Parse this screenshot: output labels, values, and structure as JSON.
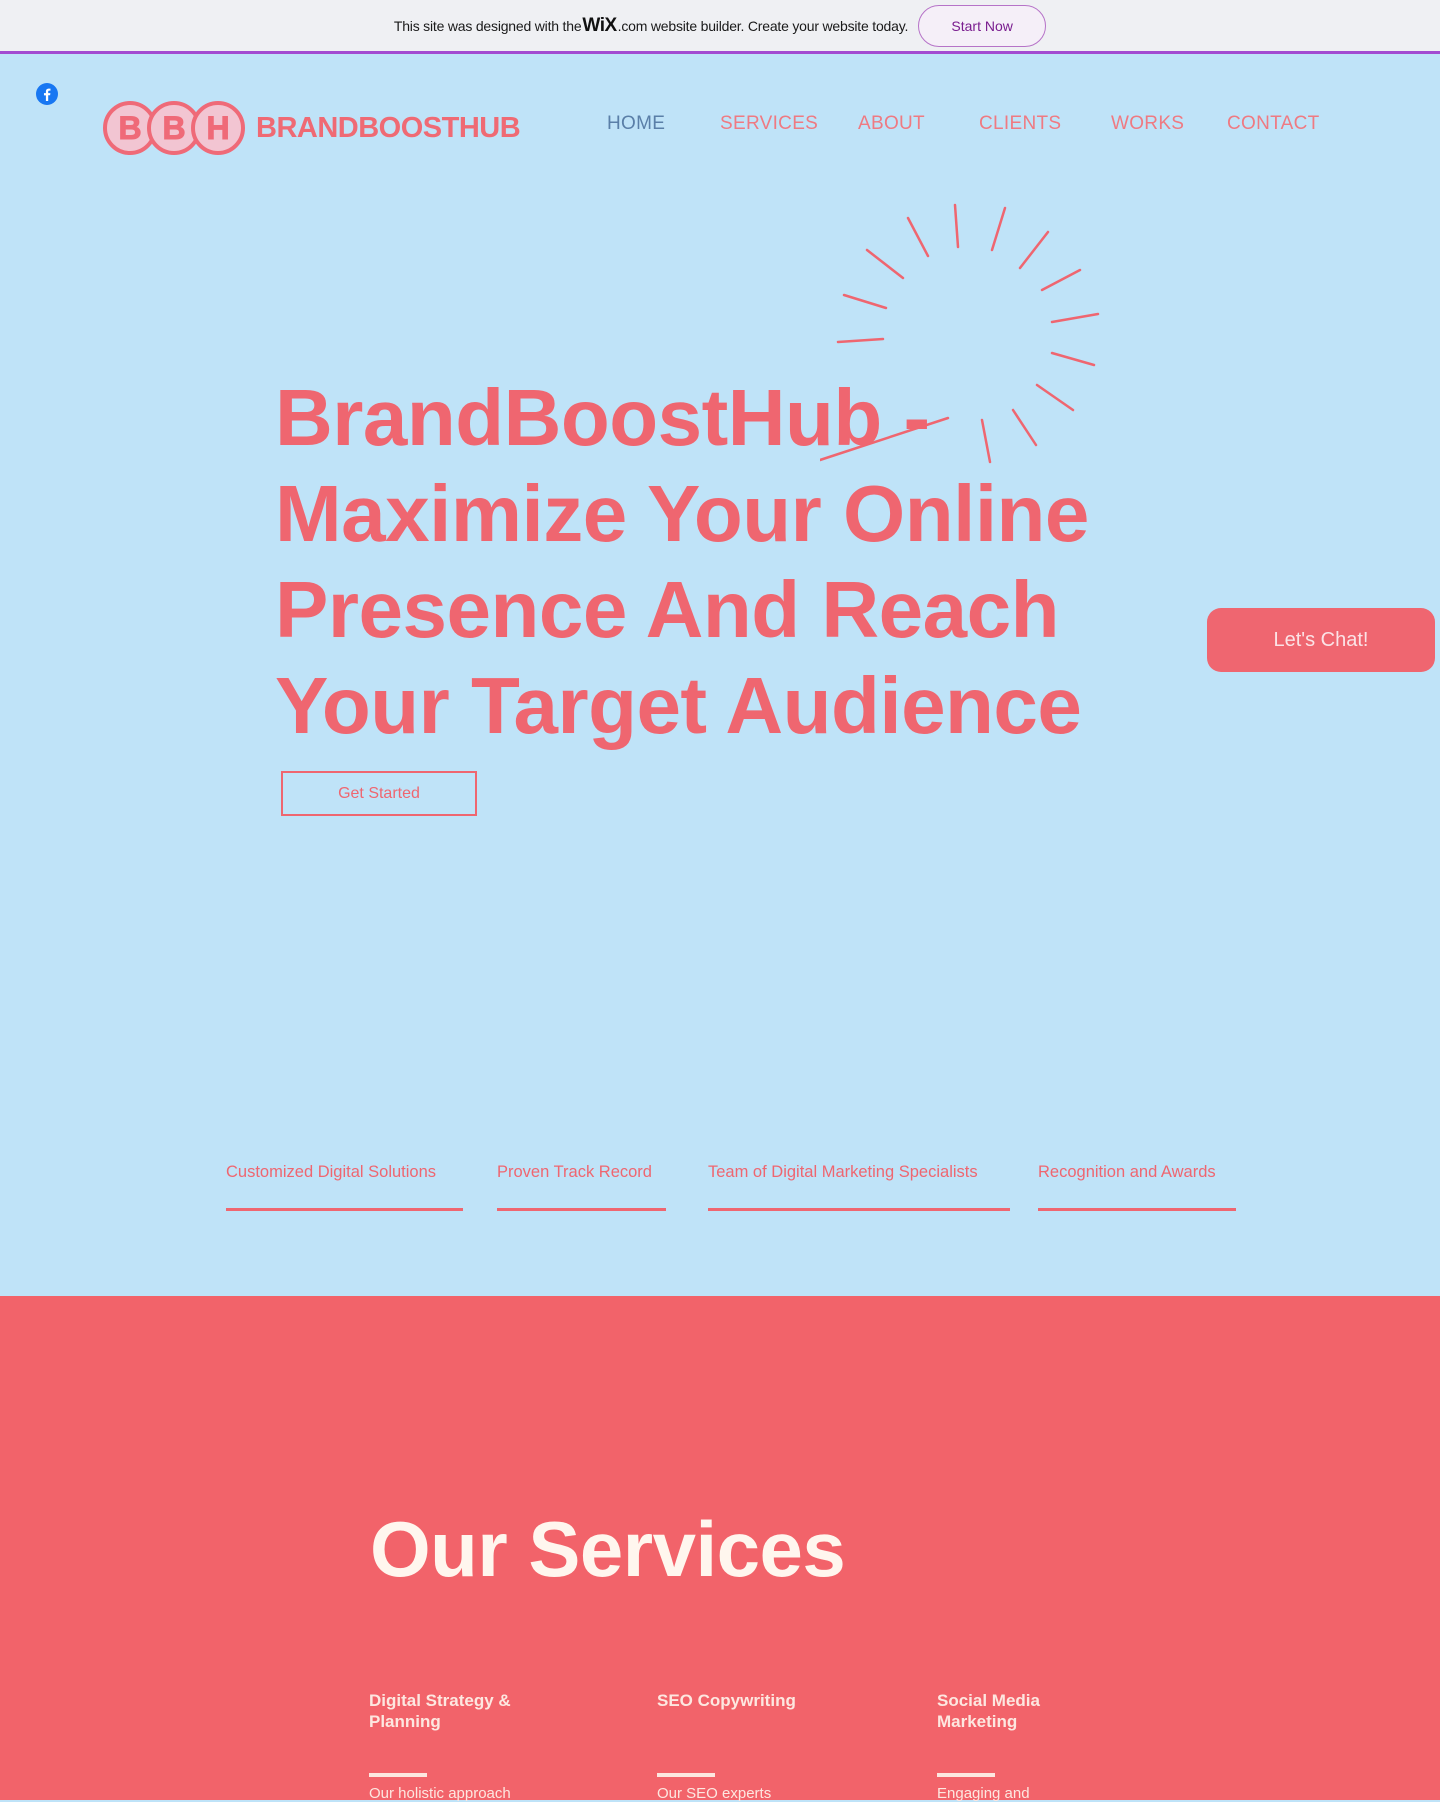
{
  "wix_banner": {
    "text_before": "This site was designed with the",
    "wix_logo": "WiX",
    "text_after": ".com website builder. Create your website today.",
    "button": "Start Now"
  },
  "header": {
    "logo_letters": [
      "B",
      "B",
      "H"
    ],
    "brand_name": "BRANDBOOSTHUB",
    "social": [
      "facebook-icon"
    ],
    "nav": [
      {
        "label": "HOME",
        "active": true
      },
      {
        "label": "SERVICES",
        "active": false
      },
      {
        "label": "ABOUT",
        "active": false
      },
      {
        "label": "CLIENTS",
        "active": false
      },
      {
        "label": "WORKS",
        "active": false
      },
      {
        "label": "CONTACT",
        "active": false
      }
    ]
  },
  "hero": {
    "title_lines": [
      "BrandBoostHub -",
      "Maximize Your Online",
      "Presence And Reach",
      "Your Target Audience"
    ],
    "cta": "Get Started",
    "chat_button": "Let's Chat!"
  },
  "features": [
    "Customized Digital Solutions",
    "Proven Track Record",
    "Team of Digital Marketing Specialists",
    "Recognition and Awards"
  ],
  "services": {
    "title": "Our Services",
    "items": [
      {
        "name": "Digital Strategy & Planning",
        "desc": "Our holistic approach"
      },
      {
        "name": "SEO Copywriting",
        "desc": "Our SEO experts"
      },
      {
        "name": "Social Media Marketing",
        "desc": "Engaging and"
      }
    ]
  },
  "colors": {
    "background": "#bfe3f8",
    "accent": "#ef6670",
    "services_bg": "#f2636a",
    "wix_accent": "#a24bd1",
    "nav_active": "#5a7fa8"
  }
}
